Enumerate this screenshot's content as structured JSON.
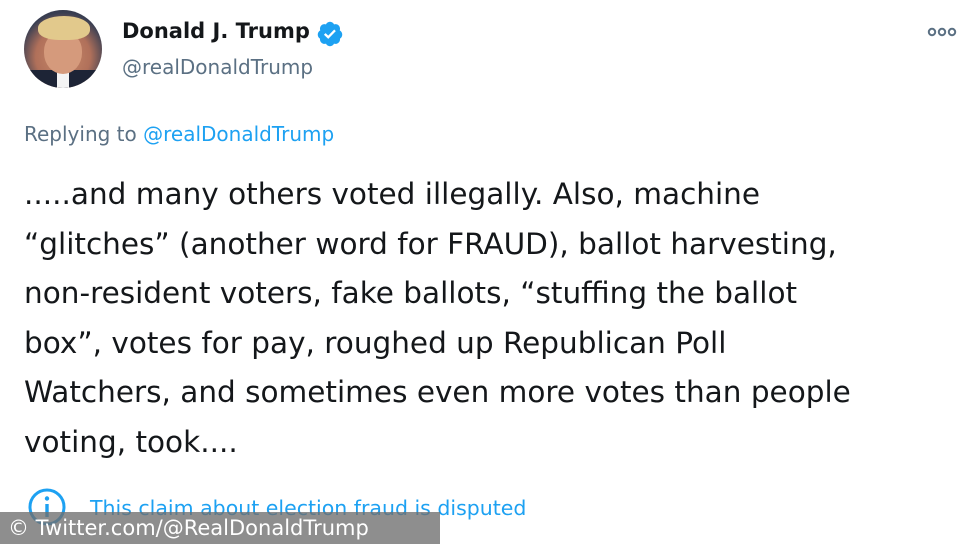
{
  "author": {
    "name": "Donald J. Trump",
    "handle": "@realDonaldTrump",
    "verified": true,
    "avatar": "profile-photo"
  },
  "actions": {
    "more_icon": "more-options-icon"
  },
  "reply": {
    "prefix": "Replying to",
    "mention": "@realDonaldTrump"
  },
  "tweet": {
    "lines": [
      ".....and many others voted illegally. Also, machine",
      "“glitches” (another word for FRAUD), ballot harvesting,",
      "non-resident voters, fake ballots, “stuffing the ballot",
      "box”, votes for pay, roughed up Republican Poll",
      "Watchers, and sometimes even more votes than people",
      "voting, took...."
    ]
  },
  "label": {
    "icon": "info-circle-icon",
    "text": "This claim about election fraud is disputed"
  },
  "watermark": {
    "text": "© Twitter.com/@RealDonaldTrump"
  },
  "colors": {
    "link_blue": "#1da1f2",
    "secondary_text": "#5b7083",
    "primary_text": "#14171a"
  }
}
